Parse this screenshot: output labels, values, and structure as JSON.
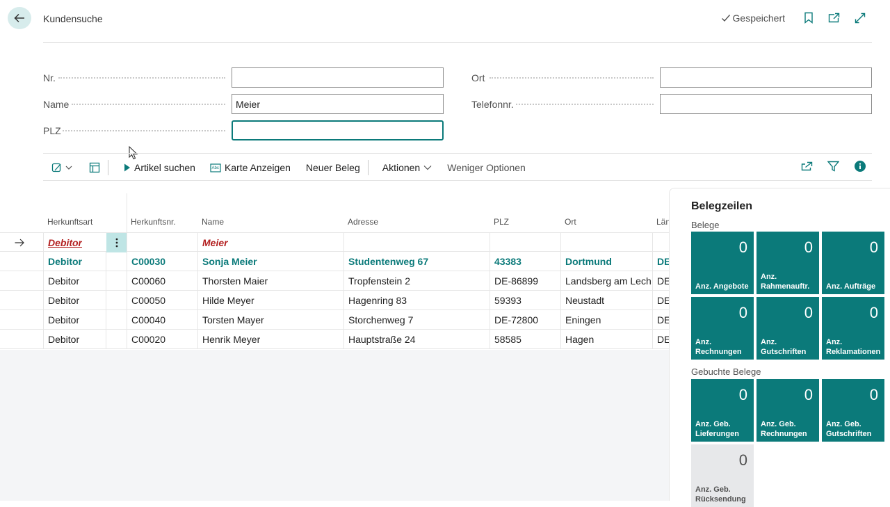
{
  "header": {
    "title": "Kundensuche",
    "saved_label": "Gespeichert"
  },
  "filters": {
    "nr_label": "Nr.",
    "nr_value": "",
    "name_label": "Name",
    "name_value": "Meier",
    "plz_label": "PLZ",
    "plz_value": "",
    "ort_label": "Ort",
    "ort_value": "",
    "telefon_label": "Telefonnr.",
    "telefon_value": ""
  },
  "toolbar": {
    "artikel_suchen": "Artikel suchen",
    "karte_anzeigen": "Karte Anzeigen",
    "neuer_beleg": "Neuer Beleg",
    "aktionen": "Aktionen",
    "weniger_optionen": "Weniger Optionen"
  },
  "grid": {
    "columns": [
      "Herkunftsart",
      "Herkunftsnr.",
      "Name",
      "Adresse",
      "PLZ",
      "Ort",
      "Län"
    ],
    "input_row": {
      "herkunftsart": "Debitor",
      "name": "Meier"
    },
    "rows": [
      [
        "Debitor",
        "C00030",
        "Sonja Meier",
        "Studentenweg 67",
        "43383",
        "Dortmund",
        "DE"
      ],
      [
        "Debitor",
        "C00060",
        "Thorsten Maier",
        "Tropfenstein 2",
        "DE-86899",
        "Landsberg am Lech",
        "DE"
      ],
      [
        "Debitor",
        "C00050",
        "Hilde Meyer",
        "Hagenring 83",
        "59393",
        "Neustadt",
        "DE"
      ],
      [
        "Debitor",
        "C00040",
        "Torsten Mayer",
        "Storchenweg 7",
        "DE-72800",
        "Eningen",
        "DE"
      ],
      [
        "Debitor",
        "C00020",
        "Henrik Meyer",
        "Hauptstraße 24",
        "58585",
        "Hagen",
        "DE"
      ]
    ]
  },
  "factbox": {
    "title": "Belegzeilen",
    "belege_label": "Belege",
    "gebuchte_label": "Gebuchte Belege",
    "belege_tiles": [
      {
        "value": "0",
        "label": "Anz. Angebote"
      },
      {
        "value": "0",
        "label": "Anz. Rahmenauftr."
      },
      {
        "value": "0",
        "label": "Anz. Aufträge"
      },
      {
        "value": "0",
        "label": "Anz. Rechnungen"
      },
      {
        "value": "0",
        "label": "Anz. Gutschriften"
      },
      {
        "value": "0",
        "label": "Anz. Reklamationen"
      }
    ],
    "gebuchte_tiles": [
      {
        "value": "0",
        "label": "Anz. Geb. Lieferungen"
      },
      {
        "value": "0",
        "label": "Anz. Geb. Rechnungen"
      },
      {
        "value": "0",
        "label": "Anz. Geb. Gutschriften"
      },
      {
        "value": "0",
        "label": "Anz. Geb. Rücksendung"
      }
    ]
  },
  "colors": {
    "accent": "#0b7a7a",
    "error": "#b32020",
    "tile_grey": "#e7e8ea"
  }
}
